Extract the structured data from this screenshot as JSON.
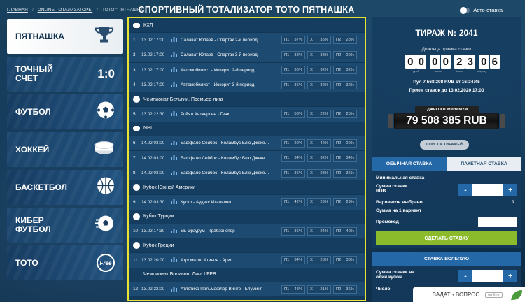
{
  "breadcrumbs": [
    "ГЛАВНАЯ",
    "ONLINE ТОТАЛИЗАТОРЫ",
    "ТОТО \"ПЯТНАШКА\""
  ],
  "page_title": "СПОРТИВНЫЙ ТОТАЛИЗАТОР ТОТО ПЯТНАШКА",
  "auto_bet_label": "Авто-ставка",
  "sidebar": [
    {
      "label": "ПЯТНАШКА",
      "icon": "trophy-icon"
    },
    {
      "label": "ТОЧНЫЙ СЧЕТ",
      "score": "1:0"
    },
    {
      "label": "ФУТБОЛ",
      "icon": "soccer-ball-icon"
    },
    {
      "label": "ХОККЕЙ",
      "icon": "hockey-puck-icon"
    },
    {
      "label": "БАСКЕТБОЛ",
      "icon": "basketball-icon"
    },
    {
      "label": "КИБЕР ФУТБОЛ",
      "icon": "cyber-football-icon"
    },
    {
      "label": "ТОТО",
      "badge": "Free"
    }
  ],
  "leagues": [
    {
      "name": "КХЛ",
      "icon": "hockey-puck-icon",
      "matches": [
        {
          "n": "1",
          "date": "13.02 17:00",
          "name": "Салават Юлаев - Спартак 2-й период",
          "p1": "37%",
          "x": "35%",
          "p2": "28%"
        },
        {
          "n": "2",
          "date": "13.02 17:00",
          "name": "Салават Юлаев - Спартак 3-й период",
          "p1": "38%",
          "x": "33%",
          "p2": "29%"
        },
        {
          "n": "3",
          "date": "13.02 17:00",
          "name": "Автомобилист - Йокерит 2-й период",
          "p1": "36%",
          "x": "32%",
          "p2": "32%"
        },
        {
          "n": "4",
          "date": "13.02 17:00",
          "name": "Автомобилист - Йокерит 3-й период",
          "p1": "36%",
          "x": "32%",
          "p2": "32%"
        }
      ]
    },
    {
      "name": "Чемпионат Бельгии. Премьер-лига",
      "icon": "soccer-ball-icon",
      "matches": [
        {
          "n": "5",
          "date": "13.02 22:30",
          "name": "Ройял Антверпен - Генк",
          "p1": "53%",
          "x": "22%",
          "p2": "25%"
        }
      ]
    },
    {
      "name": "NHL",
      "icon": "hockey-puck-icon",
      "matches": [
        {
          "n": "6",
          "date": "14.02 03:00",
          "name": "Баффало Сейбрс - Коламбус Блю Джеке…",
          "p1": "29%",
          "x": "42%",
          "p2": "29%"
        },
        {
          "n": "7",
          "date": "14.02 03:00",
          "name": "Баффало Сейбрс - Коламбус Блю Джеке…",
          "p1": "34%",
          "x": "32%",
          "p2": "34%"
        },
        {
          "n": "8",
          "date": "14.02 03:00",
          "name": "Баффало Сейбрс - Коламбус Блю Джеке…",
          "p1": "36%",
          "x": "28%",
          "p2": "36%"
        }
      ]
    },
    {
      "name": "Кубок Южной Америки",
      "icon": "soccer-ball-icon",
      "matches": [
        {
          "n": "9",
          "date": "14.02 03:30",
          "name": "Куско - Аудакс Итальяно",
          "p1": "42%",
          "x": "29%",
          "p2": "29%"
        }
      ]
    },
    {
      "name": "Кубок Турции",
      "icon": "soccer-ball-icon",
      "matches": [
        {
          "n": "10",
          "date": "13.02 17:30",
          "name": "ББ Эрзурум - Трабзонспор",
          "p1": "36%",
          "x": "24%",
          "p2": "40%"
        }
      ]
    },
    {
      "name": "Кубок Греции",
      "icon": "soccer-ball-icon",
      "matches": [
        {
          "n": "11",
          "date": "13.02 20:00",
          "name": "Атромитос Атинон - Арис",
          "p1": "34%",
          "x": "28%",
          "p2": "38%"
        }
      ]
    },
    {
      "name": "Чемпионат Боливии. Лига LFPB",
      "icon": "",
      "matches": [
        {
          "n": "12",
          "date": "13.02 22:00",
          "name": "Атлетико Пальмафлор Винто - Блуминг",
          "p1": "43%",
          "x": "21%",
          "p2": "36%"
        }
      ]
    }
  ],
  "odd_labels": {
    "p1": "П1",
    "x": "Х",
    "p2": "П2"
  },
  "draw": {
    "title": "ТИРАЖ № 2041",
    "deadline_label": "До конца приема ставок",
    "timer_digits": [
      "0",
      "0",
      "0",
      "0",
      "2",
      "3",
      "0",
      "6"
    ],
    "timer_units": [
      "дней",
      "часов",
      "минут",
      "секунд"
    ],
    "pool": "Пул 7 568 208 RUB от 16:34:45",
    "accept": "Прием ставок до 13.02.2020 17:00",
    "jackpot_label": "ДЖЕКПОТ МИНИМУМ",
    "jackpot_value": "79 508 385 RUB",
    "draws_list": "СПИСОК ТИРАЖЕЙ"
  },
  "bet": {
    "tab_normal": "ОБЫЧНАЯ СТАВКА",
    "tab_package": "ПАКЕТНАЯ СТАВКА",
    "min_bet": "Минимальная ставка",
    "amount": "Сумма ставки RUB",
    "variants": "Вариантов выбрано",
    "variants_value": "0",
    "per_variant": "Сумма на 1 вариант",
    "promo": "Промокод",
    "submit": "СДЕЛАТЬ СТАВКУ",
    "blind_title": "СТАВКА ВСЛЕПУЮ",
    "blind_amount": "Сумма ставки на один купон",
    "blind_count": "Число",
    "minus": "-",
    "plus": "+"
  },
  "ask": {
    "label": "ЗАДАТЬ ВОПРОС",
    "status": "on-line"
  }
}
